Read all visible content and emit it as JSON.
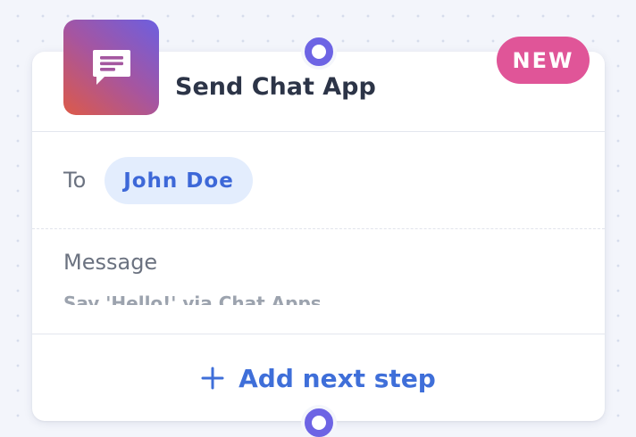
{
  "node": {
    "title": "Send Chat App",
    "badge": "NEW",
    "icon": "chat-message-icon",
    "to": {
      "label": "To",
      "recipient": "John Doe"
    },
    "message": {
      "label": "Message",
      "preview": "Say 'Hello!' via Chat Apps"
    },
    "add_step_label": "Add next step",
    "add_step_icon": "plus-icon"
  },
  "colors": {
    "accent": "#3f6fd9",
    "badge": "#e05598",
    "connector": "#6d64e4",
    "chip_bg": "#e3edfd",
    "icon_gradient": [
      "#dd5a48",
      "#a655a0",
      "#6c5fe0"
    ]
  }
}
